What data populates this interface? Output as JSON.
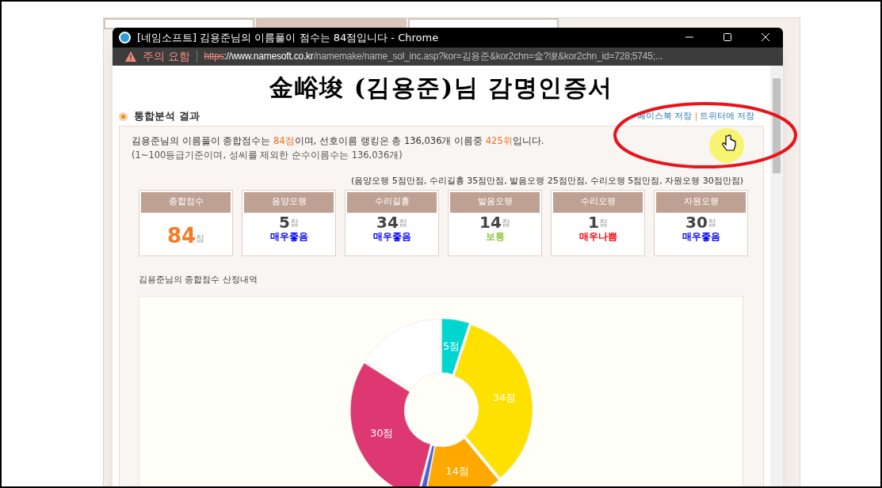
{
  "background_tabs": [
    {
      "selected": false
    },
    {
      "selected": true
    },
    {
      "selected": false
    }
  ],
  "window": {
    "title": "[네임소프트] 김용준님의 이름풀이 점수는 84점입니다 - Chrome",
    "security": "주의 요함",
    "url_scheme": "https",
    "url_host": "://www.namesoft.co.kr",
    "url_path": "/namemake/name_sol_inc.asp?kor=김용준&kor2chn=金?埈&kor2chn_id=728;5745;..."
  },
  "heading": "金峪埈 (김용준)님 감명인증서",
  "section": {
    "title": "통합분석 결과",
    "share_links": [
      "페이스북 저장",
      "트위터에 저장"
    ]
  },
  "summary": {
    "line1": "김용준님의 이름풀이 종합점수는 **84점**이며, 선호이름 랭킹은 총 136,036개 이름중 **425위**입니다.",
    "line2": "(1~100등급기준이며, 성씨를 제외한 순수이름수는 136,036개)"
  },
  "max_note": "(음양오행 5점만점, 수리길흉 35점만점, 발음오행 25점만점, 수리오행 5점만점, 자원오행 30점만점)",
  "score_cards": [
    {
      "kind": "total",
      "label": "종합점수",
      "score": "84",
      "unit": "점"
    },
    {
      "kind": "item",
      "label": "음양오행",
      "score": "5",
      "unit": "점",
      "rating": "매우좋음",
      "color": "#0000ff"
    },
    {
      "kind": "item",
      "label": "수리길흉",
      "score": "34",
      "unit": "점",
      "rating": "매우좋음",
      "color": "#0000ff"
    },
    {
      "kind": "item",
      "label": "발음오행",
      "score": "14",
      "unit": "점",
      "rating": "보통",
      "color": "#8cc63f"
    },
    {
      "kind": "item",
      "label": "수리오행",
      "score": "1",
      "unit": "점",
      "rating": "매우나쁨",
      "color": "#ff0000"
    },
    {
      "kind": "item",
      "label": "자원오행",
      "score": "30",
      "unit": "점",
      "rating": "매우좋음",
      "color": "#0000ff"
    }
  ],
  "chart_caption": "김용준님의 종합점수 산정내역",
  "chart": {
    "chart_data": {
      "type": "donut",
      "values": [
        5,
        34,
        14,
        1,
        30,
        16
      ],
      "colors": [
        "#00d6d0",
        "#ffe100",
        "#ffa800",
        "#4b5fd6",
        "#de3872",
        "#ffffff"
      ],
      "value_labels": [
        "5점",
        "34점",
        "14점",
        null,
        "30점",
        null
      ]
    }
  }
}
